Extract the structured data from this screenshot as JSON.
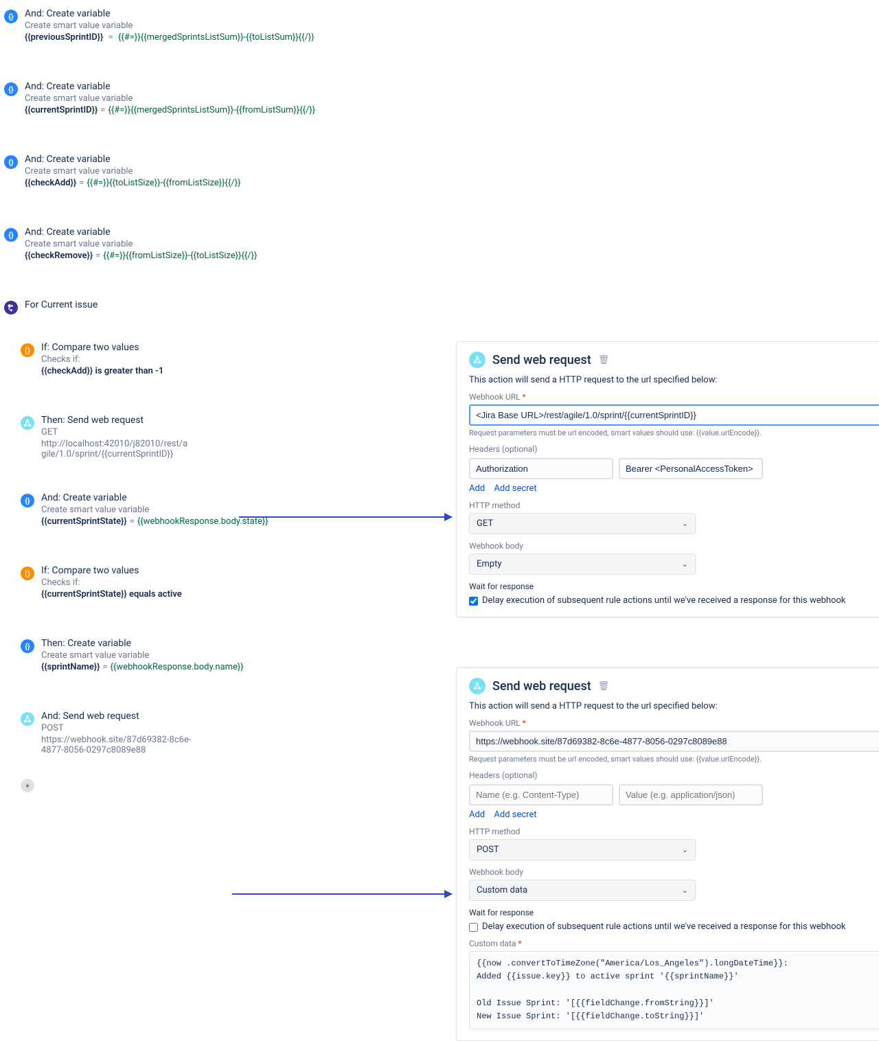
{
  "steps": {
    "var1": {
      "title": "And: Create variable",
      "sub": "Create smart value variable",
      "name": "{{previousSprintID}}",
      "value": "{{#=}}{{mergedSprintsListSum}}-{{toListSum}}{{/}}"
    },
    "var2": {
      "title": "And: Create variable",
      "sub": "Create smart value variable",
      "name": "{{currentSprintID}}",
      "value": "{{#=}}{{mergedSprintsListSum}}-{{fromListSum}}{{/}}"
    },
    "var3": {
      "title": "And: Create variable",
      "sub": "Create smart value variable",
      "name": "{{checkAdd}}",
      "value": "{{#=}}{{toListSize}}-{{fromListSize}}{{/}}"
    },
    "var4": {
      "title": "And: Create variable",
      "sub": "Create smart value variable",
      "name": "{{checkRemove}}",
      "value": "{{#=}}{{fromListSize}}-{{toListSize}}{{/}}"
    },
    "branch": {
      "title": "For Current issue"
    },
    "cond1": {
      "title": "If: Compare two values",
      "sub": "Checks if:",
      "detail": "{{checkAdd}} is greater than -1"
    },
    "web1": {
      "title": "Then: Send web request",
      "method": "GET",
      "url": "http://localhost:42010/j82010/rest/agile/1.0/sprint/{{currentSprintID}}"
    },
    "var5": {
      "title": "And: Create variable",
      "sub": "Create smart value variable",
      "name": "{{currentSprintState}}",
      "value": "{{webhookResponse.body.state}}"
    },
    "cond2": {
      "title": "If: Compare two values",
      "sub": "Checks if:",
      "detail": "{{currentSprintState}} equals active"
    },
    "var6": {
      "title": "Then: Create variable",
      "sub": "Create smart value variable",
      "name": "{{sprintName}}",
      "value": "{{webhookResponse.body.name}}"
    },
    "web2": {
      "title": "And: Send web request",
      "method": "POST",
      "url": "https://webhook.site/87d69382-8c6e-4877-8056-0297c8089e88"
    }
  },
  "panel1": {
    "title": "Send web request",
    "desc": "This action will send a HTTP request to the url specified below:",
    "webhook_label": "Webhook URL",
    "webhook_value": "<Jira Base URL>/rest/agile/1.0/sprint/{{currentSprintID}}",
    "url_hint": "Request parameters must be url encoded, smart values should use: {{value.urlEncode}}.",
    "headers_label": "Headers (optional)",
    "header_name": "Authorization",
    "header_value": "Bearer <PersonalAccessToken>",
    "add": "Add",
    "add_secret": "Add secret",
    "method_label": "HTTP method",
    "method": "GET",
    "body_label": "Webhook body",
    "body": "Empty",
    "wait_label": "Wait for response",
    "wait_text": "Delay execution of subsequent rule actions until we've received a response for this webhook"
  },
  "panel2": {
    "title": "Send web request",
    "desc": "This action will send a HTTP request to the url specified below:",
    "webhook_label": "Webhook URL",
    "webhook_value": "https://webhook.site/87d69382-8c6e-4877-8056-0297c8089e88",
    "url_hint": "Request parameters must be url encoded, smart values should use: {{value.urlEncode}}.",
    "headers_label": "Headers (optional)",
    "header_name_ph": "Name (e.g. Content-Type)",
    "header_value_ph": "Value (e.g. application/json)",
    "add": "Add",
    "add_secret": "Add secret",
    "method_label": "HTTP method",
    "method": "POST",
    "body_label": "Webhook body",
    "body": "Custom data",
    "wait_label": "Wait for response",
    "wait_text": "Delay execution of subsequent rule actions until we've received a response for this webhook",
    "custom_label": "Custom data",
    "custom_value": "{{now .convertToTimeZone(\"America/Los_Angeles\").longDateTime}}:\nAdded {{issue.key}} to active sprint '{{sprintName}}'\n\nOld Issue Sprint: '[{{fieldChange.fromString}}]'\nNew Issue Sprint: '[{{fieldChange.toString}}]'"
  }
}
